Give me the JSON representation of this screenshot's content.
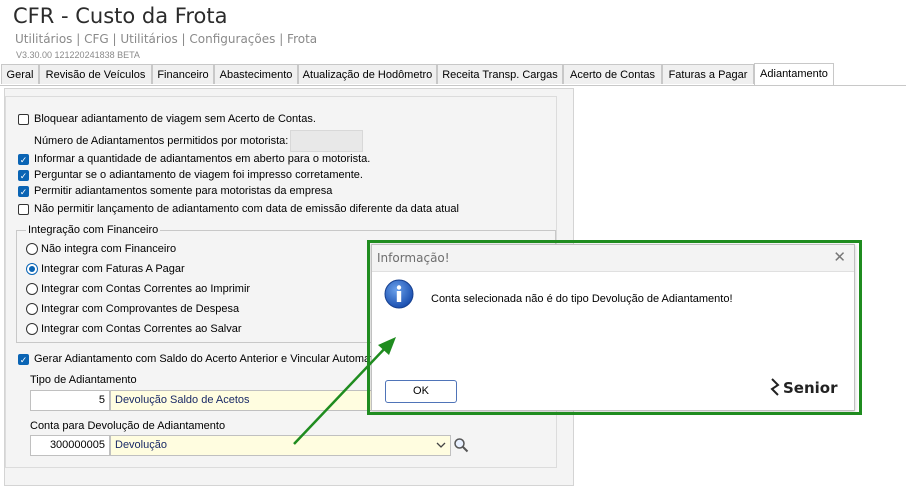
{
  "app": {
    "title": "CFR - Custo da Frota",
    "breadcrumb": "Utilitários | CFG | Utilitários | Configurações | Frota",
    "version": "V3.30.00 121220241838 BETA"
  },
  "tabs": [
    {
      "label": "Geral"
    },
    {
      "label": "Revisão de Veículos"
    },
    {
      "label": "Financeiro"
    },
    {
      "label": "Abastecimento"
    },
    {
      "label": "Atualização de Hodômetro"
    },
    {
      "label": "Receita Transp. Cargas"
    },
    {
      "label": "Acerto de Contas"
    },
    {
      "label": "Faturas a Pagar"
    },
    {
      "label": "Adiantamento"
    }
  ],
  "form": {
    "block_label": "Bloquear adiantamento de viagem sem Acerto de Contas.",
    "block_checked": false,
    "count_label": "Número de Adiantamentos permitidos por motorista:",
    "option1": "Informar a quantidade de adiantamentos em aberto para o motorista.",
    "option2": "Perguntar se o adiantamento de viagem foi impresso corretamente.",
    "option3": "Permitir adiantamentos somente para motoristas da empresa",
    "option4": "Não permitir lançamento de adiantamento com data de emissão diferente da data atual",
    "integration": {
      "title": "Integração com Financeiro",
      "options": [
        "Não integra com Financeiro",
        "Integrar com Faturas A Pagar",
        "Integrar com Contas Correntes ao Imprimir",
        "Integrar com Comprovantes de Despesa",
        "Integrar com Contas Correntes ao Salvar"
      ],
      "selected": "Integrar com Faturas A Pagar"
    },
    "generate_label": "Gerar Adiantamento com Saldo do Acerto Anterior e Vincular Automat",
    "type_label": "Tipo de Adiantamento",
    "type_code": "5",
    "type_desc": "Devolução Saldo de Acetos",
    "account_label": "Conta para Devolução de Adiantamento",
    "account_code": "300000005",
    "account_desc": "Devolução"
  },
  "dialog": {
    "title": "Informação!",
    "message": "Conta selecionada não é do tipo Devolução de Adiantamento!",
    "ok_label": "OK",
    "brand": "Senior",
    "icon": "info-icon",
    "highlight_color": "#1f8c1f"
  }
}
